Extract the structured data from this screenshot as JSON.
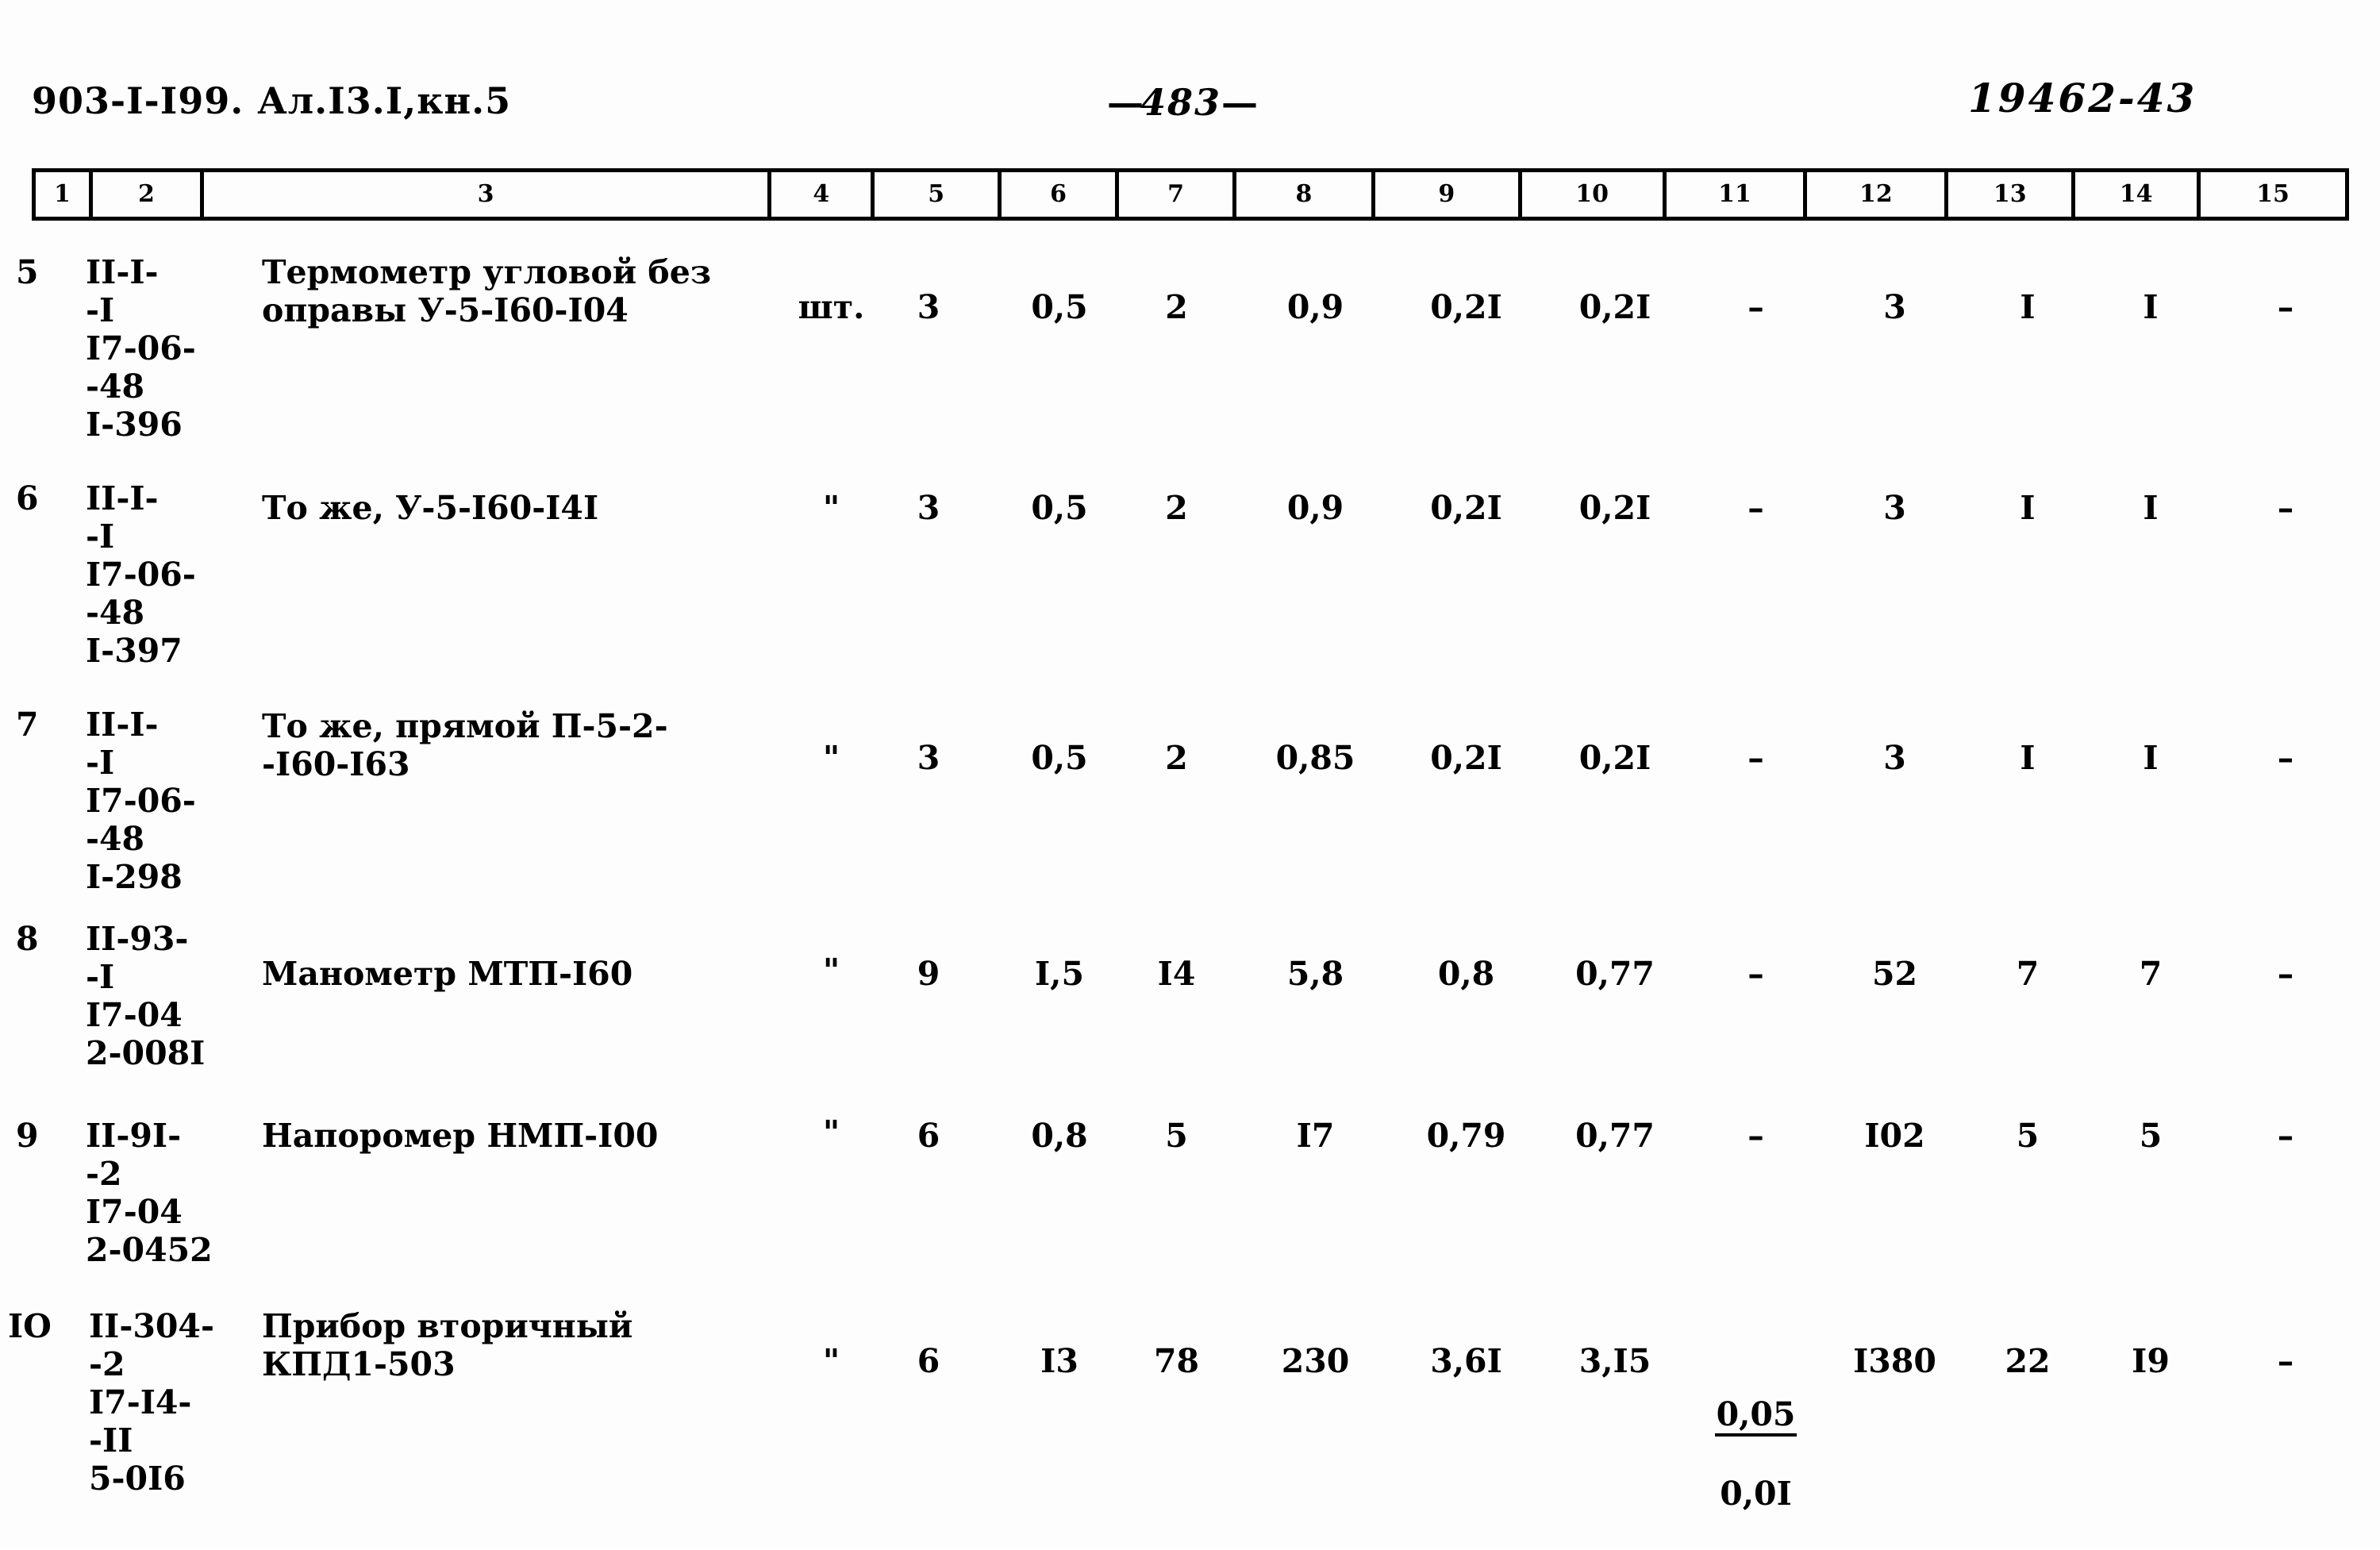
{
  "header": {
    "doc_code": "903-I-I99. Ал.I3.I,кн.5",
    "page_number": "483",
    "page_number_prefix": "—",
    "page_number_suffix": "—",
    "archive_number": "19462-43"
  },
  "table": {
    "column_headers": [
      "1",
      "2",
      "3",
      "4",
      "5",
      "6",
      "7",
      "8",
      "9",
      "10",
      "11",
      "12",
      "13",
      "14",
      "15"
    ],
    "rows": [
      {
        "num": "5",
        "code": "II-I-\n-I\nI7-06-\n-48\nI-396",
        "name": "Термометр угловой без\nоправы У-5-I60-I04",
        "unit": "шт.",
        "c5": "3",
        "c6": "0,5",
        "c7": "2",
        "c8": "0,9",
        "c9": "0,2I",
        "c10": "0,2I",
        "c11": "–",
        "c12": "3",
        "c13": "I",
        "c14": "I",
        "c15": "–"
      },
      {
        "num": "6",
        "code": "II-I-\n-I\nI7-06-\n-48\nI-397",
        "name": "То же, У-5-I60-I4I",
        "unit": "\"",
        "c5": "3",
        "c6": "0,5",
        "c7": "2",
        "c8": "0,9",
        "c9": "0,2I",
        "c10": "0,2I",
        "c11": "–",
        "c12": "3",
        "c13": "I",
        "c14": "I",
        "c15": "–"
      },
      {
        "num": "7",
        "code": "II-I-\n-I\nI7-06-\n-48\nI-298",
        "name": "То же, прямой П-5-2-\n-I60-I63",
        "unit": "\"",
        "c5": "3",
        "c6": "0,5",
        "c7": "2",
        "c8": "0,85",
        "c9": "0,2I",
        "c10": "0,2I",
        "c11": "–",
        "c12": "3",
        "c13": "I",
        "c14": "I",
        "c15": "–"
      },
      {
        "num": "8",
        "code": "II-93-\n-I\nI7-04\n2-008I",
        "name": "Манометр МТП-I60",
        "unit": "\"",
        "c5": "9",
        "c6": "I,5",
        "c7": "I4",
        "c8": "5,8",
        "c9": "0,8",
        "c10": "0,77",
        "c11": "–",
        "c12": "52",
        "c13": "7",
        "c14": "7",
        "c15": "–"
      },
      {
        "num": "9",
        "code": "II-9I-\n-2\nI7-04\n2-0452",
        "name": "Напоромер НМП-I00",
        "unit": "\"",
        "c5": "6",
        "c6": "0,8",
        "c7": "5",
        "c8": "I7",
        "c9": "0,79",
        "c10": "0,77",
        "c11": "–",
        "c12": "I02",
        "c13": "5",
        "c14": "5",
        "c15": "–"
      },
      {
        "num": "IO",
        "code": "II-304-\n-2\nI7-I4-\n-II\n5-0I6",
        "name": "Прибор вторичный\nКПД1-503",
        "unit": "\"",
        "c5": "6",
        "c6": "I3",
        "c7": "78",
        "c8": "230",
        "c9": "3,6I",
        "c10": "3,I5",
        "c11_fraction": {
          "numerator": "0,05",
          "denominator": "0,0I"
        },
        "c12": "I380",
        "c13": "22",
        "c14": "I9",
        "c15": "–"
      }
    ]
  }
}
